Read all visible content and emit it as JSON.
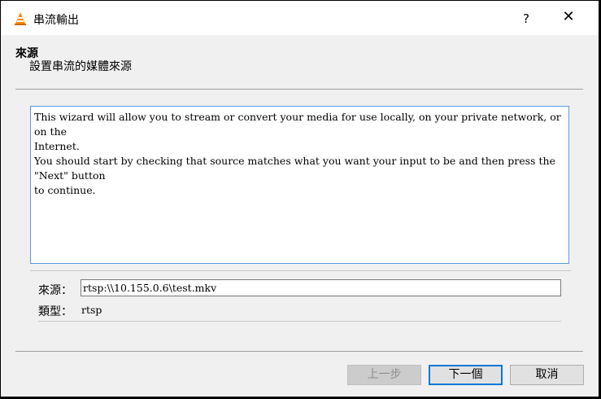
{
  "window": {
    "title": "串流輸出",
    "help_label": "?",
    "close_label": "✕",
    "icon": "vlc-cone-icon"
  },
  "header": {
    "title": "來源",
    "subtitle": "設置串流的媒體來源"
  },
  "description": "This wizard will allow you to stream or convert your media for use locally, on your private network, or on the\nInternet.\nYou should start by checking that source matches what you want your input to be and then press the \"Next\" button\nto continue.",
  "source": {
    "label": "來源：",
    "value": "rtsp:\\\\10.155.0.6\\test.mkv"
  },
  "type": {
    "label": "類型：",
    "value": "rtsp"
  },
  "buttons": {
    "back": "上一步",
    "next": "下一個",
    "cancel": "取消"
  },
  "colors": {
    "accent": "#0078d7",
    "focus_border": "#569de5"
  }
}
